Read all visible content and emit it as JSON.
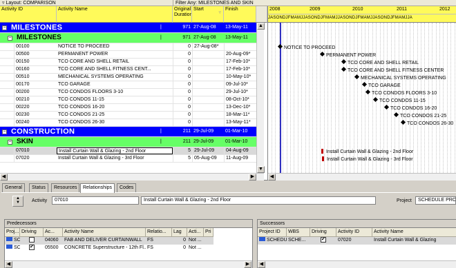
{
  "header": {
    "layout_label": "Layout: COMPARISON",
    "filter_label": "Filter Any: MILESTONES AND SKIN"
  },
  "columns": {
    "activity_id": "Activity ID",
    "activity_name": "Activity Name",
    "original_duration": "Original Duration",
    "start": "Start",
    "finish": "Finish"
  },
  "rows": [
    {
      "type": "group1",
      "id": "",
      "name": "MILESTONES",
      "dur": "971",
      "start": "27-Aug-08",
      "finish": "13-May-11"
    },
    {
      "type": "group2",
      "id": "",
      "name": "MILESTONES",
      "dur": "971",
      "start": "27-Aug-08",
      "finish": "13-May-11"
    },
    {
      "type": "task",
      "id": "00100",
      "name": "NOTICE TO PROCEED",
      "dur": "0",
      "start": "27-Aug-08*",
      "finish": ""
    },
    {
      "type": "task",
      "id": "00500",
      "name": "PERMANENT POWER",
      "dur": "0",
      "start": "",
      "finish": "20-Aug-09*"
    },
    {
      "type": "task",
      "id": "00150",
      "name": "TCO CORE AND SHELL RETAIL",
      "dur": "0",
      "start": "",
      "finish": "17-Feb-10*"
    },
    {
      "type": "task",
      "id": "00160",
      "name": "TCO CORE AND SHELL FITNESS CENT...",
      "dur": "0",
      "start": "",
      "finish": "17-Feb-10*"
    },
    {
      "type": "task",
      "id": "00510",
      "name": "MECHANICAL SYSTEMS OPERATING",
      "dur": "0",
      "start": "",
      "finish": "10-May-10*"
    },
    {
      "type": "task",
      "id": "00170",
      "name": "TCO GARAGE",
      "dur": "0",
      "start": "",
      "finish": "09-Jul-10*"
    },
    {
      "type": "task",
      "id": "00200",
      "name": "TCO CONDOS FLOORS 3-10",
      "dur": "0",
      "start": "",
      "finish": "29-Jul-10*"
    },
    {
      "type": "task",
      "id": "00210",
      "name": "TCO CONDOS 11-15",
      "dur": "0",
      "start": "",
      "finish": "08-Oct-10*"
    },
    {
      "type": "task",
      "id": "00220",
      "name": "TCO CONDOS 16-20",
      "dur": "0",
      "start": "",
      "finish": "13-Dec-10*"
    },
    {
      "type": "task",
      "id": "00230",
      "name": "TCO CONDOS 21-25",
      "dur": "0",
      "start": "",
      "finish": "18-Mar-11*"
    },
    {
      "type": "task",
      "id": "00240",
      "name": "TCO CONDOS 26-30",
      "dur": "0",
      "start": "",
      "finish": "13-May-11*"
    },
    {
      "type": "group1",
      "id": "",
      "name": "CONSTRUCTION",
      "dur": "211",
      "start": "29-Jul-09",
      "finish": "01-Mar-10"
    },
    {
      "type": "group2",
      "id": "",
      "name": "SKIN",
      "dur": "211",
      "start": "29-Jul-09",
      "finish": "01-Mar-10"
    },
    {
      "type": "sel",
      "id": "07010",
      "name": "Install Curtain Wall & Glazing - 2nd Floor",
      "dur": "5",
      "start": "29-Jul-09",
      "finish": "04-Aug-09"
    },
    {
      "type": "task",
      "id": "07020",
      "name": "Install Curtain Wall & Glazing - 3rd  Floor",
      "dur": "5",
      "start": "05-Aug-09",
      "finish": "11-Aug-09"
    }
  ],
  "gantt": {
    "years": [
      "2008",
      "2009",
      "2010",
      "2011",
      "2012"
    ],
    "months": "JASONDJFMAMJJASONDJFMAMJJASONDJFMAMJJASONDJFMAMJJA",
    "milestones": [
      "NOTICE TO PROCEED",
      "PERMANENT POWER",
      "TCO CORE AND SHELL RETAIL",
      "TCO CORE AND SHELL FITNESS CENTER",
      "MECHANICAL SYSTEMS OPERATING",
      "TCO GARAGE",
      "TCO CONDOS FLOORS 3-10",
      "TCO CONDOS 11-15",
      "TCO CONDOS 16-20",
      "TCO CONDOS 21-25",
      "TCO CONDOS 26-30"
    ],
    "bars": [
      "Install Curtain Wall & Glazing - 2nd Floor",
      "Install Curtain Wall & Glazing - 3rd  Floor"
    ]
  },
  "tabs": [
    "General",
    "Status",
    "Resources",
    "Relationships",
    "Codes"
  ],
  "detail": {
    "activity_label": "Activity",
    "activity_id": "07010",
    "activity_name": "Install Curtain Wall & Glazing - 2nd Floor",
    "project_label": "Project",
    "project_value": "SCHEDULE PRO"
  },
  "predecessors": {
    "title": "Predecessors",
    "headers": [
      "Proj...",
      "Driving",
      "Ac...",
      "Activity Name",
      "Relatio...",
      "Lag",
      "Acti...",
      "Pri"
    ],
    "rows": [
      {
        "proj": "SCI",
        "driving": false,
        "id": "04060",
        "name": "FAB AND DELIVER CURTAINWALL",
        "rel": "FS",
        "lag": "0",
        "acti": "Not ..."
      },
      {
        "proj": "SCI",
        "driving": true,
        "id": "05500",
        "name": "CONCRETE Superstructure - 12th Fl...",
        "rel": "FS",
        "lag": "0",
        "acti": "Not ..."
      }
    ]
  },
  "successors": {
    "title": "Successors",
    "headers": [
      "Project ID",
      "WBS",
      "Driving",
      "Activity ID",
      "Activity Name"
    ],
    "rows": [
      {
        "proj": "SCHEDULE",
        "wbs": "SCHE...",
        "driving": true,
        "id": "07020",
        "name": "Install Curtain Wall & Glazing"
      }
    ]
  }
}
